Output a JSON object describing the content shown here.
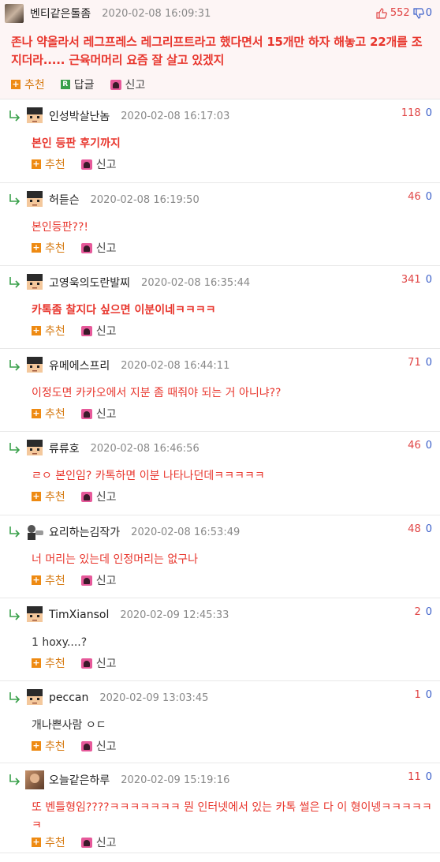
{
  "top_comment": {
    "nickname": "벤티같은톨좀",
    "date": "2020-02-08 16:09:31",
    "up_count": "552",
    "down_count": "0",
    "body": "존나 약올라서 레그프레스 레그리프트라고 했다면서 15개만 하자 해놓고 22개를 조지더라..... 근육머머리 요즘 잘 살고 있겠지",
    "recommend_label": "추천",
    "reply_label": "답글",
    "report_label": "신고"
  },
  "reply_labels": {
    "recommend": "추천",
    "report": "신고"
  },
  "replies": [
    {
      "nickname": "인성박살난놈",
      "date": "2020-02-08 16:17:03",
      "up": "118",
      "down": "0",
      "body": "본인 등판 후기까지",
      "bold": true,
      "avatar": "pixel"
    },
    {
      "nickname": "허듣슨",
      "date": "2020-02-08 16:19:50",
      "up": "46",
      "down": "0",
      "body": "본인등판??!",
      "bold": false,
      "avatar": "pixel"
    },
    {
      "nickname": "고영욱의도란발찌",
      "date": "2020-02-08 16:35:44",
      "up": "341",
      "down": "0",
      "body": "카톡좀 찰지다 싶으면 이분이네ㅋㅋㅋㅋ",
      "bold": true,
      "avatar": "pixel"
    },
    {
      "nickname": "유메에스프리",
      "date": "2020-02-08 16:44:11",
      "up": "71",
      "down": "0",
      "body": "이정도면 카카오에서 지분 좀 때줘야 되는 거 아니냐??",
      "bold": false,
      "avatar": "pixel"
    },
    {
      "nickname": "류류호",
      "date": "2020-02-08 16:46:56",
      "up": "46",
      "down": "0",
      "body": "ㄹㅇ 본인임? 카톡하면 이분 나타나던데ㅋㅋㅋㅋㅋ",
      "bold": false,
      "avatar": "pixel"
    },
    {
      "nickname": "요리하는김작가",
      "date": "2020-02-08 16:53:49",
      "up": "48",
      "down": "0",
      "body": "너 머리는 있는데 인정머리는 없구나",
      "bold": false,
      "avatar": "cook"
    },
    {
      "nickname": "TimXiansol",
      "date": "2020-02-09 12:45:33",
      "up": "2",
      "down": "0",
      "body": "1 hoxy....?",
      "bold": false,
      "avatar": "pixel",
      "plain": true
    },
    {
      "nickname": "peccan",
      "date": "2020-02-09 13:03:45",
      "up": "1",
      "down": "0",
      "body": "개나쁜사람 ㅇㄷ",
      "bold": false,
      "avatar": "pixel",
      "plain": true
    },
    {
      "nickname": "오늘같은하루",
      "date": "2020-02-09 15:19:16",
      "up": "11",
      "down": "0",
      "body": "또 벤틀형임????ㅋㅋㅋㅋㅋㅋㅋ 뭔 인터넷에서 있는 카톡 썰은 다 이 형이넹ㅋㅋㅋㅋㅋㅋ",
      "bold": false,
      "avatar": "photo"
    }
  ]
}
